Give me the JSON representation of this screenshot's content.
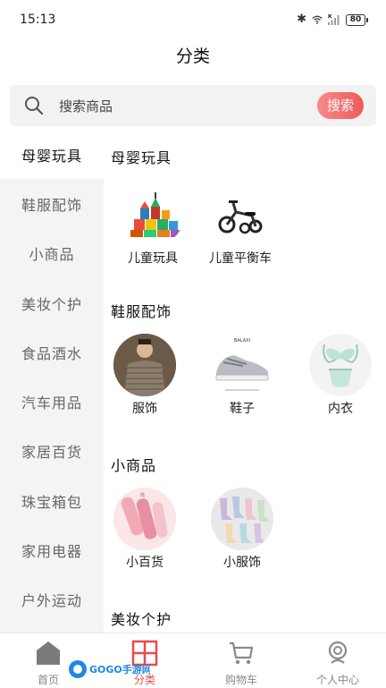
{
  "status": {
    "time": "15:13",
    "battery": "80"
  },
  "page_title": "分类",
  "search": {
    "placeholder": "搜索商品",
    "button_label": "搜索"
  },
  "sidebar": {
    "items": [
      {
        "label": "母婴玩具",
        "active": true
      },
      {
        "label": "鞋服配饰"
      },
      {
        "label": "小商品"
      },
      {
        "label": "美妆个护"
      },
      {
        "label": "食品酒水"
      },
      {
        "label": "汽车用品"
      },
      {
        "label": "家居百货"
      },
      {
        "label": "珠宝箱包"
      },
      {
        "label": "家用电器"
      },
      {
        "label": "户外运动"
      }
    ]
  },
  "sections": [
    {
      "title": "母婴玩具",
      "products": [
        {
          "label": "儿童玩具"
        },
        {
          "label": "儿童平衡车"
        }
      ]
    },
    {
      "title": "鞋服配饰",
      "products": [
        {
          "label": "服饰"
        },
        {
          "label": "鞋子"
        },
        {
          "label": "内衣"
        }
      ]
    },
    {
      "title": "小商品",
      "products": [
        {
          "label": "小百货"
        },
        {
          "label": "小服饰"
        }
      ]
    },
    {
      "title": "美妆个护",
      "products": []
    }
  ],
  "tabbar": {
    "tabs": [
      {
        "label": "首页",
        "icon": "home-icon"
      },
      {
        "label": "分类",
        "icon": "category-grid-icon",
        "active": true
      },
      {
        "label": "购物车",
        "icon": "cart-icon"
      },
      {
        "label": "个人中心",
        "icon": "profile-icon"
      }
    ]
  },
  "watermark": {
    "text": "GOGO手游网"
  },
  "colors": {
    "accent": "#e94b4b",
    "sidebar_bg": "#f4f4f4",
    "search_bg": "#f2f2f2"
  }
}
